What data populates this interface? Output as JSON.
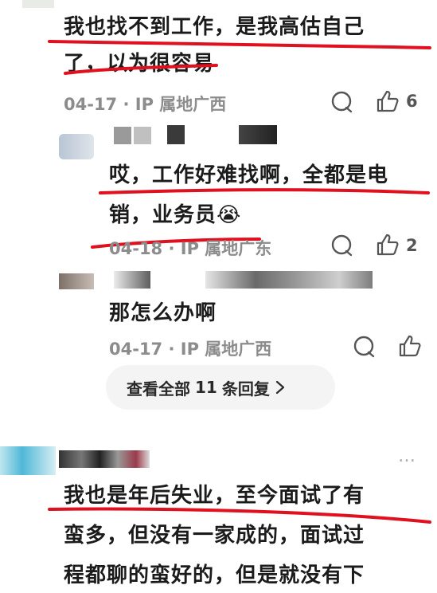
{
  "comments": [
    {
      "text_line1": "我也找不到工作，是我高估自己",
      "text_line2": "了，以为很容易",
      "date": "04-17",
      "location": "IP 属地广西",
      "likes": "6"
    },
    {
      "text_line1": "哎，工作好难找啊，全都是电",
      "text_line2": "销，业务员",
      "emoji": "😭",
      "date": "04-18",
      "location": "IP 属地广东",
      "likes": "2"
    },
    {
      "text_line1": "那怎么办啊",
      "date": "04-17",
      "location": "IP 属地广西"
    },
    {
      "text_line1": "我也是年后失业，至今面试了有",
      "text_line2": "蛮多，但没有一家成的，面试过",
      "text_line3": "程都聊的蛮好的，但是就没有下"
    }
  ],
  "view_replies": {
    "prefix": "查看全部",
    "count": "11",
    "suffix": "条回复"
  },
  "more_icon": "…",
  "icons": {
    "comment": "comment-bubble-icon",
    "like": "thumbs-up-icon",
    "more": "more-dots-icon",
    "chevron": "chevron-right-icon"
  },
  "colors": {
    "annotation_red": "#e0101f",
    "meta_gray": "#8c8c8c",
    "pill_bg": "#f4f4f4"
  }
}
